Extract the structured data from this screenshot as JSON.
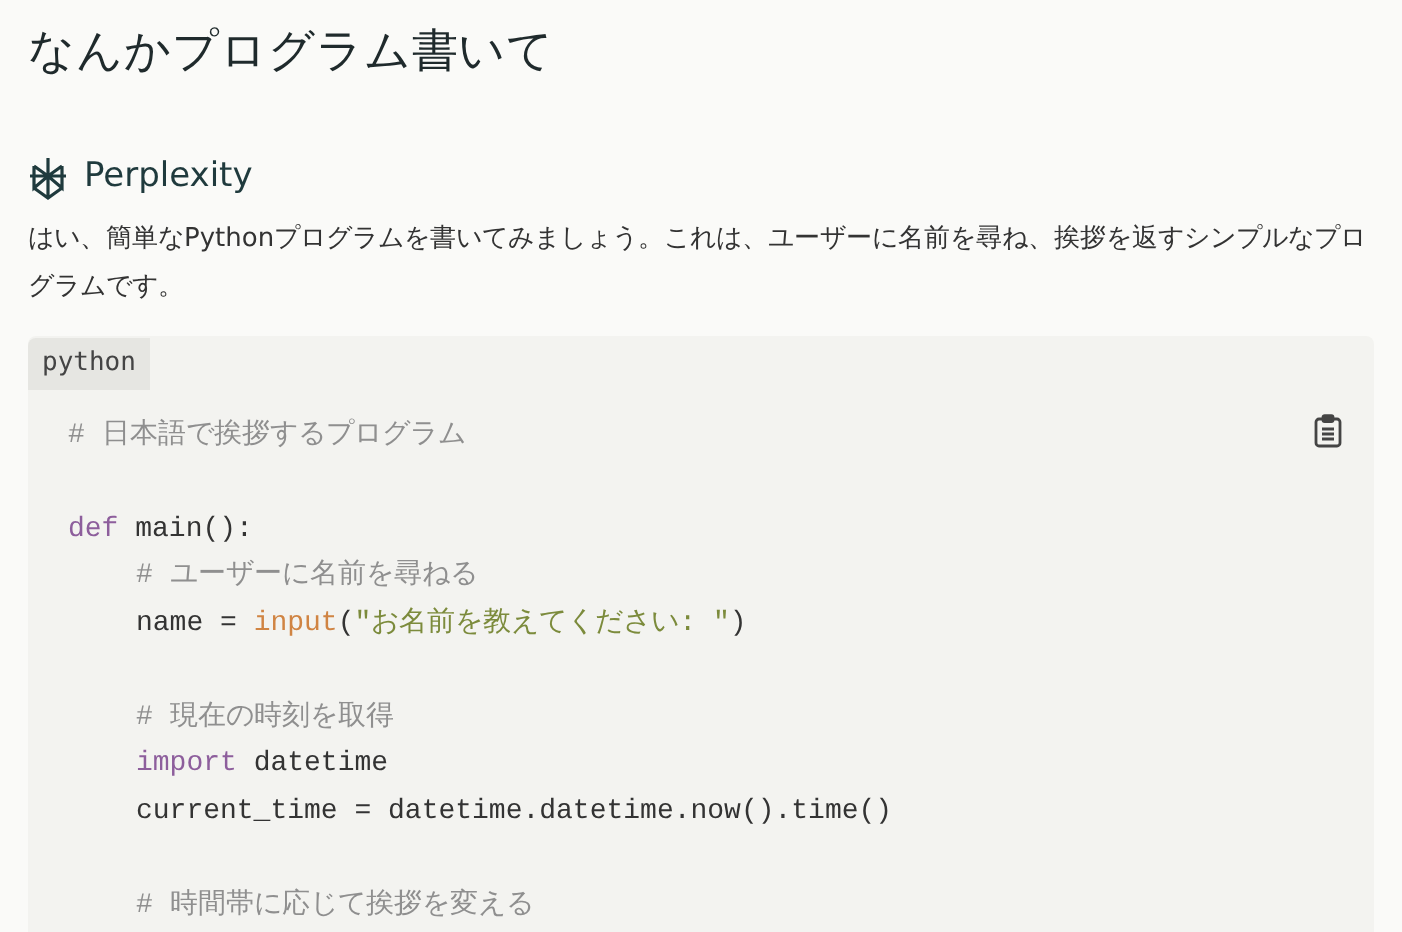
{
  "title": "なんかプログラム書いて",
  "answer": {
    "source": "Perplexity",
    "text": "はい、簡単なPythonプログラムを書いてみましょう。これは、ユーザーに名前を尋ね、挨拶を返すシンプルなプログラムです。"
  },
  "code_block": {
    "language": "python",
    "lines": [
      {
        "kind": "code",
        "tokens": [
          {
            "kind": "comment",
            "text": "# 日本語で挨拶するプログラム"
          }
        ]
      },
      {
        "kind": "blank"
      },
      {
        "kind": "code",
        "tokens": [
          {
            "kind": "keyword",
            "text": "def"
          },
          {
            "kind": "plain",
            "text": " main():"
          }
        ],
        "children": [
          {
            "kind": "code",
            "tokens": [
              {
                "kind": "comment",
                "text": "# ユーザーに名前を尋ねる"
              }
            ]
          },
          {
            "kind": "code",
            "tokens": [
              {
                "kind": "plain",
                "text": "name = "
              },
              {
                "kind": "builtin",
                "text": "input"
              },
              {
                "kind": "plain",
                "text": "("
              },
              {
                "kind": "string",
                "text": "\"お名前を教えてください: \""
              },
              {
                "kind": "plain",
                "text": ")"
              }
            ]
          },
          {
            "kind": "blank"
          },
          {
            "kind": "code",
            "tokens": [
              {
                "kind": "comment",
                "text": "# 現在の時刻を取得"
              }
            ]
          },
          {
            "kind": "code",
            "tokens": [
              {
                "kind": "keyword",
                "text": "import"
              },
              {
                "kind": "plain",
                "text": " datetime"
              }
            ]
          },
          {
            "kind": "code",
            "tokens": [
              {
                "kind": "plain",
                "text": "current_time = datetime.datetime.now().time()"
              }
            ]
          },
          {
            "kind": "blank"
          },
          {
            "kind": "code",
            "tokens": [
              {
                "kind": "comment",
                "text": "# 時間帯に応じて挨拶を変える"
              }
            ]
          }
        ]
      }
    ]
  }
}
